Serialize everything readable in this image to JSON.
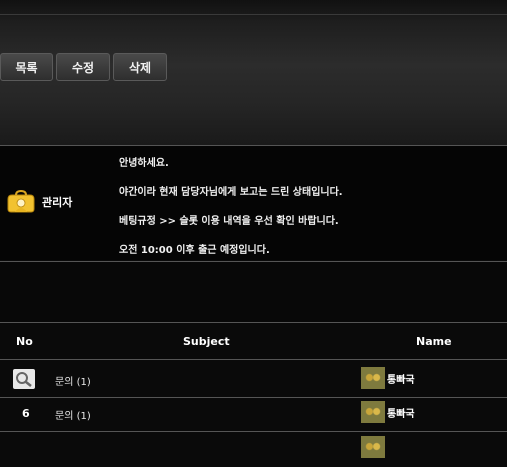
{
  "toolbar": {
    "list_label": "목록",
    "edit_label": "수정",
    "delete_label": "삭제"
  },
  "post": {
    "author": "관리자",
    "author_icon": "admin-badge-icon",
    "lines": [
      "안녕하세요.",
      "야간이라 현재 담당자님에게 보고는 드린 상태입니다.",
      "베팅규정 >> 슬롯 이용 내역을 우선 확인 바랍니다.",
      "오전 10:00 이후 출근 예정입니다."
    ]
  },
  "table": {
    "headers": {
      "no": "No",
      "subject": "Subject",
      "name": "Name"
    },
    "rows": [
      {
        "no": "",
        "no_icon": "search-icon",
        "subject": "문의 (1)",
        "name": "통빠국"
      },
      {
        "no": "6",
        "subject": "문의 (1)",
        "name": "통빠국"
      },
      {
        "no": "",
        "subject": "",
        "name": ""
      }
    ]
  },
  "colors": {
    "background": "#0a0a0a",
    "admin_icon": "#f2c230",
    "avatar": "#7e7a3e"
  }
}
